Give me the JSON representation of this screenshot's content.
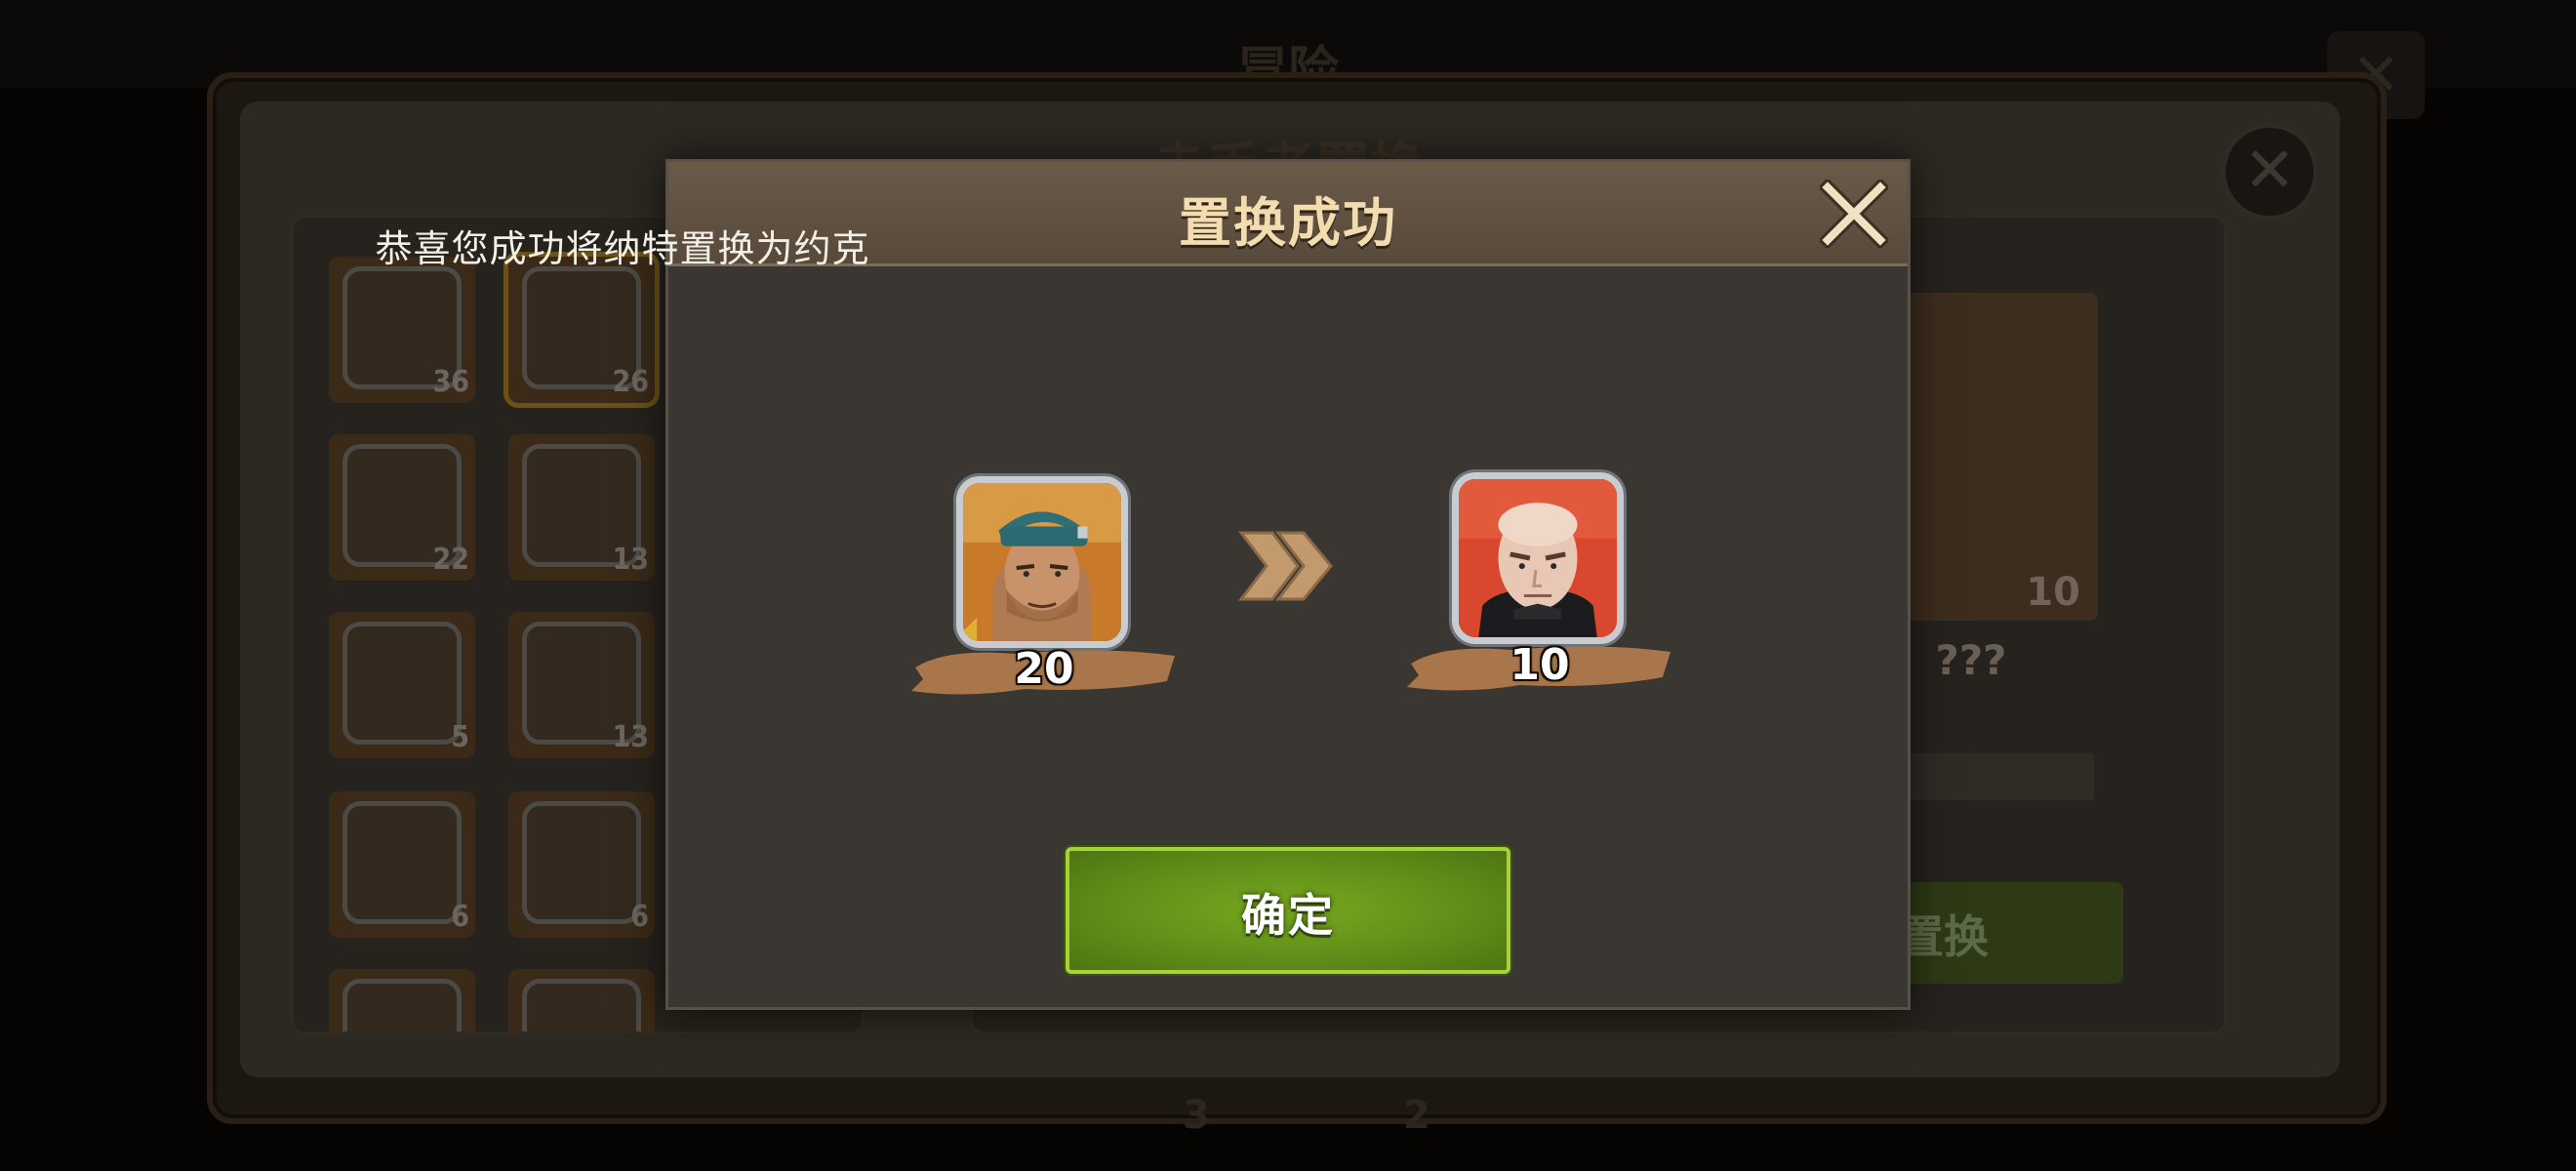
{
  "background": {
    "top_title": "冒险",
    "panel_title": "赤手者置换",
    "hero_counts": [
      "36",
      "26",
      "22",
      "13",
      "5",
      "13",
      "6",
      "6"
    ],
    "target_count": "10",
    "target_name": "???",
    "replace_button_label": "置换",
    "bottom_counts": [
      "3",
      "2"
    ]
  },
  "dialog": {
    "title": "置换成功",
    "message": "恭喜您成功将纳特置换为约克",
    "from_hero": {
      "count": "20",
      "icon": "hero-natt-portrait"
    },
    "to_hero": {
      "count": "10",
      "icon": "hero-york-portrait"
    },
    "confirm_label": "确定",
    "close_icon": "close-x-icon",
    "arrow_icon": "double-chevron-right-icon"
  },
  "colors": {
    "dialog_title": "#f3dcb0",
    "confirm_green": "#6a9a1c",
    "count_banner": "#a8764a"
  }
}
